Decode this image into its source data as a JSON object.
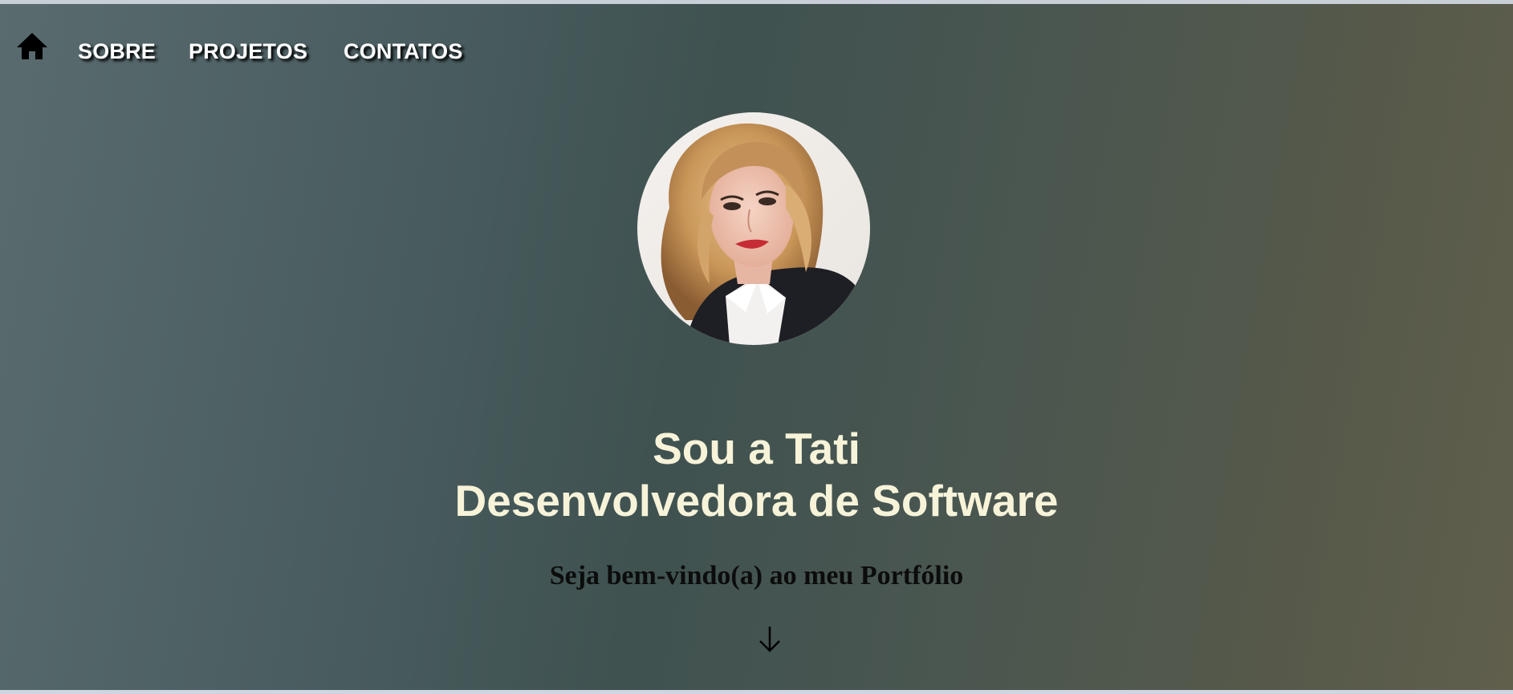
{
  "nav": {
    "home_icon": "home-icon",
    "items": [
      {
        "label": "SOBRE"
      },
      {
        "label": "PROJETOS"
      },
      {
        "label": "CONTATOS"
      }
    ]
  },
  "hero": {
    "avatar_icon": "profile-photo",
    "title_line1": "Sou a Tati",
    "title_line2": "Desenvolvedora de Software",
    "welcome": "Seja bem-vindo(a) ao meu Portfólio",
    "scroll_icon": "arrow-down-icon"
  },
  "colors": {
    "nav_text": "#ffffff",
    "heading_text": "#f7f3d9",
    "welcome_text": "#0c0c0c",
    "gradient_start": "#596b6f",
    "gradient_mid": "#3f5250",
    "gradient_end": "#605f4c"
  }
}
